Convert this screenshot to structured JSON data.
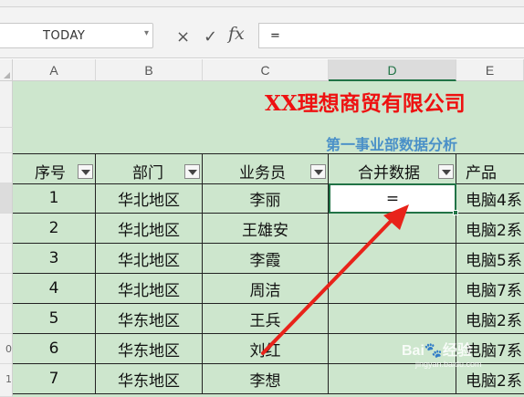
{
  "formula_bar": {
    "name_box": "TODAY",
    "cancel_icon": "×",
    "enter_icon": "✓",
    "fx_label": "fx",
    "formula_value": "="
  },
  "columns": [
    "A",
    "B",
    "C",
    "D",
    "E"
  ],
  "rows": [
    "",
    "",
    "",
    "",
    "",
    "",
    "",
    "0",
    "1"
  ],
  "sheet": {
    "title": "XX理想商贸有限公司",
    "subtitle": "第一事业部数据分析",
    "headers": [
      "序号",
      "部门",
      "业务员",
      "合并数据",
      "产品"
    ],
    "active_cell_value": "=",
    "records": [
      {
        "no": "1",
        "dept": "华北地区",
        "rep": "李丽",
        "merged": "",
        "product": "电脑4系"
      },
      {
        "no": "2",
        "dept": "华北地区",
        "rep": "王雄安",
        "merged": "",
        "product": "电脑2系"
      },
      {
        "no": "3",
        "dept": "华北地区",
        "rep": "李霞",
        "merged": "",
        "product": "电脑5系"
      },
      {
        "no": "4",
        "dept": "华北地区",
        "rep": "周洁",
        "merged": "",
        "product": "电脑7系"
      },
      {
        "no": "5",
        "dept": "华东地区",
        "rep": "王兵",
        "merged": "",
        "product": "电脑2系"
      },
      {
        "no": "6",
        "dept": "华东地区",
        "rep": "刘红",
        "merged": "",
        "product": "电脑7系"
      },
      {
        "no": "7",
        "dept": "华东地区",
        "rep": "李想",
        "merged": "",
        "product": "电脑2系"
      }
    ]
  },
  "watermark": {
    "brand": "Bai🐾经验",
    "url": "jingyan.baidu.com"
  },
  "colors": {
    "grid_green": "#cde6cd",
    "title_red": "#ee1111",
    "subtitle_blue": "#4a90c8",
    "selection_green": "#217346",
    "arrow_red": "#e8231a"
  }
}
